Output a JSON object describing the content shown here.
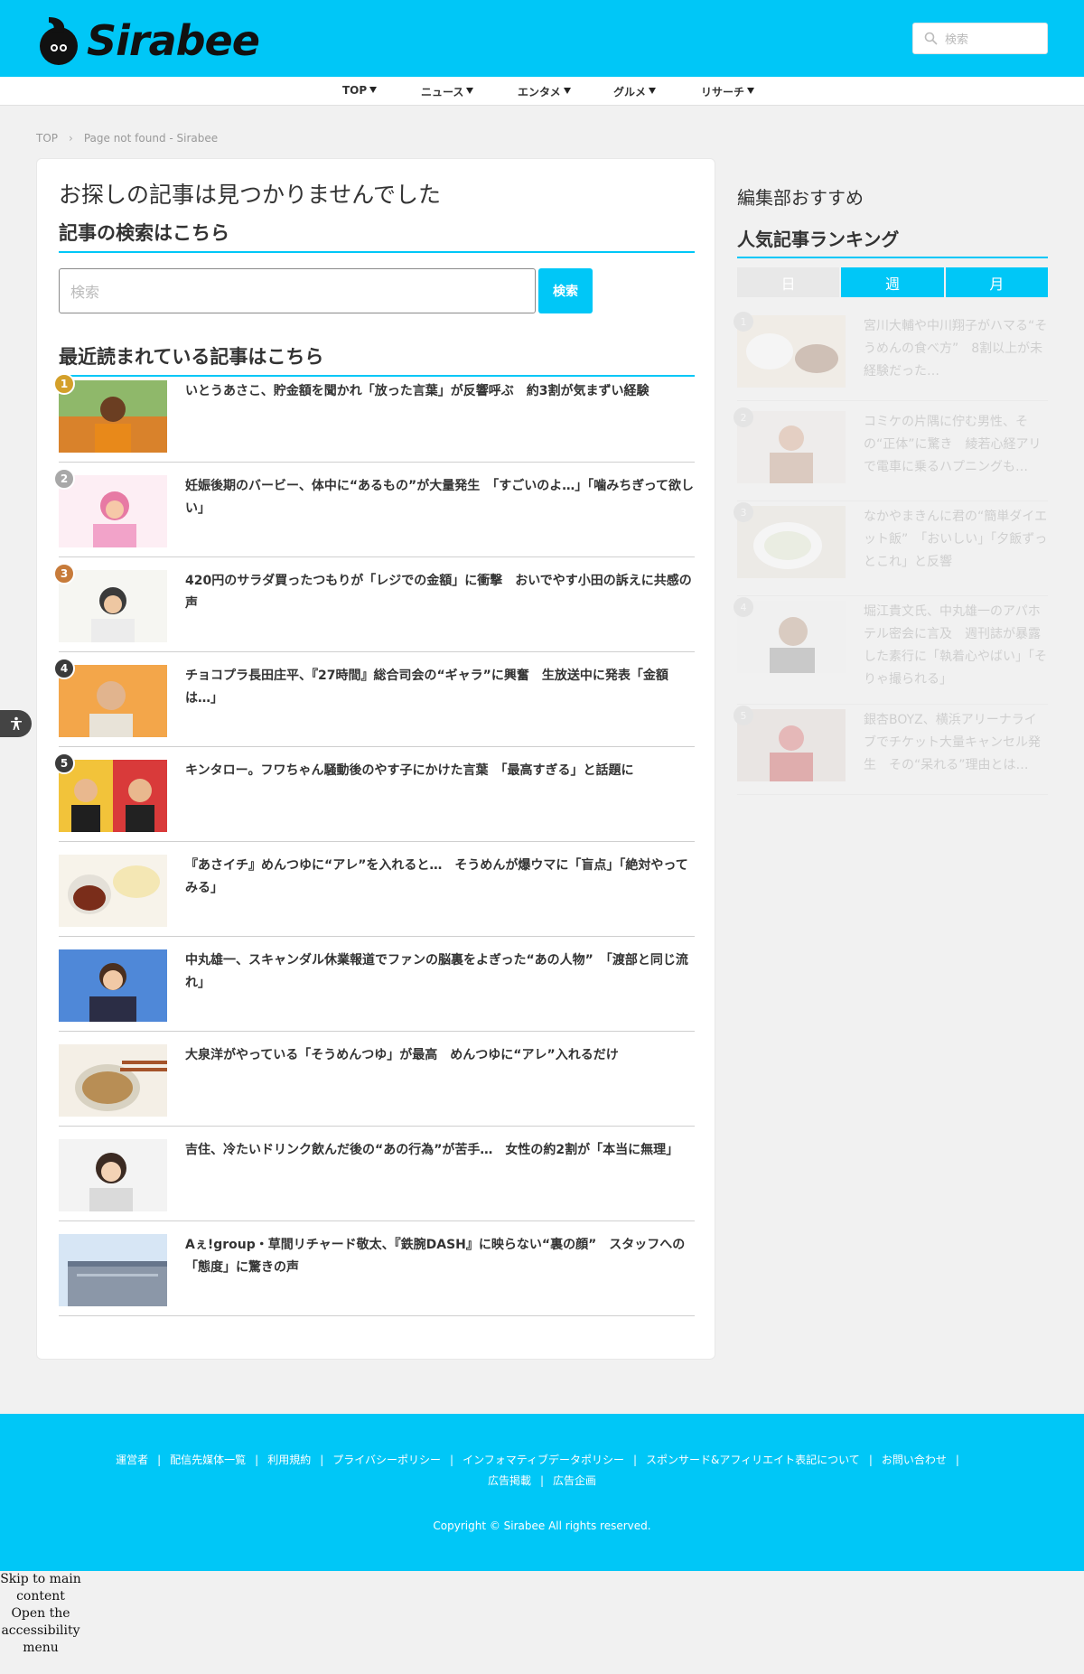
{
  "brand": {
    "logo_text": "Sirabee",
    "accent": "#00c7f7"
  },
  "header": {
    "search_placeholder": "検索"
  },
  "nav": [
    {
      "label": "TOP"
    },
    {
      "label": "ニュース"
    },
    {
      "label": "エンタメ"
    },
    {
      "label": "グルメ"
    },
    {
      "label": "リサーチ"
    }
  ],
  "breadcrumb": {
    "home": "TOP",
    "current": "Page not found - Sirabee"
  },
  "main": {
    "not_found": "お探しの記事は見つかりませんでした",
    "search_heading": "記事の検索はこちら",
    "search_placeholder": "検索",
    "search_button": "検索",
    "recent_heading": "最近読まれている記事はこちら",
    "articles": [
      {
        "rank": "1",
        "title": "いとうあさこ、貯金額を聞かれ「放った言葉」が反響呼ぶ　約3割が気まずい経験"
      },
      {
        "rank": "2",
        "title": "妊娠後期のバービー、体中に“あるもの”が大量発生　「すごいのよ…」「噛みちぎって欲しい」"
      },
      {
        "rank": "3",
        "title": "420円のサラダ買ったつもりが「レジでの金額」に衝撃　おいでやす小田の訴えに共感の声"
      },
      {
        "rank": "4",
        "title": "チョコプラ長田庄平、『27時間』総合司会の“ギャラ”に興奮　生放送中に発表「金額は…」"
      },
      {
        "rank": "5",
        "title": "キンタロー。フワちゃん騒動後のやす子にかけた言葉　「最高すぎる」と話題に"
      },
      {
        "rank": "",
        "title": "『あさイチ』めんつゆに“アレ”を入れると…　そうめんが爆ウマに「盲点」「絶対やってみる」"
      },
      {
        "rank": "",
        "title": "中丸雄一、スキャンダル休業報道でファンの脳裏をよぎった“あの人物”　「渡部と同じ流れ」"
      },
      {
        "rank": "",
        "title": "大泉洋がやっている「そうめんつゆ」が最高　めんつゆに“アレ”入れるだけ"
      },
      {
        "rank": "",
        "title": "吉住、冷たいドリンク飲んだ後の“あの行為”が苦手…　女性の約2割が「本当に無理」"
      },
      {
        "rank": "",
        "title": "Aぇ!group・草間リチャード敬太、『鉄腕DASH』に映らない“裏の顔”　スタッフへの「態度」に驚きの声"
      }
    ]
  },
  "sidebar": {
    "recommend_heading": "編集部おすすめ",
    "ranking_heading": "人気記事ランキング",
    "tabs": [
      "日",
      "週",
      "月"
    ],
    "items": [
      {
        "rank": "1",
        "title": "宮川大輔や中川翔子がハマる“そうめんの食べ方”　8割以上が未経験だった…"
      },
      {
        "rank": "2",
        "title": "コミケの片隅に佇む男性、その“正体”に驚き　綾若心経アリで電車に乗るハプニングも…"
      },
      {
        "rank": "3",
        "title": "なかやまきんに君の“簡単ダイエット飯”　「おいしい」「夕飯ずっとこれ」と反響"
      },
      {
        "rank": "4",
        "title": "堀江貴文氏、中丸雄一のアパホテル密会に言及　週刊誌が暴露した素行に「執着心やばい」「そりゃ撮られる」"
      },
      {
        "rank": "5",
        "title": "銀杏BOYZ、横浜アリーナライブでチケット大量キャンセル発生　その“呆れる”理由とは…"
      }
    ]
  },
  "footer": {
    "links": [
      "運営者",
      "配信先媒体一覧",
      "利用規約",
      "プライバシーポリシー",
      "インフォマティブデータポリシー",
      "スポンサード&アフィリエイト表記について",
      "お問い合わせ",
      "広告掲載",
      "広告企画"
    ],
    "copyright": "Copyright © Sirabee All rights reserved."
  },
  "skip": {
    "main": "Skip to main content",
    "accessibility": "Open the accessibility menu"
  }
}
